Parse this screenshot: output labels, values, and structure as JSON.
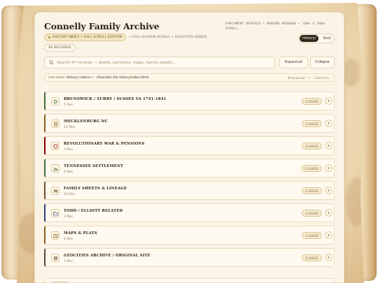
{
  "header": {
    "title": "Connelly Family Archive",
    "meta_right": "PARCHMENT #F0F5E3 • MAROON #880000 • 100% X 100% SCROLL",
    "badge": "HISTORY INDEX • FULL SCROLL EDITION",
    "badge_note": "• FULL-SCREEN SCROLL • GEOCITIES ADDED",
    "records": "46 RECORDS",
    "toggle": {
      "option_a": "History/",
      "option_b": "Root"
    }
  },
  "toolbar": {
    "search_placeholder": "Search 47 records — deeds, pensions, maps, family sheets...",
    "expand_label": "Expand all",
    "collapse_label": "Collapse"
  },
  "linkbar": {
    "mode_label": "Link mode:",
    "mode_value": "History/ relative • ../Geocities (for History/index.html)",
    "right": "Brunswick/ → ../Geociti…"
  },
  "rows": [
    {
      "name": "BRUNSWICK / SURRY / SUSSEX VA 1741-1841",
      "files": "5 files",
      "status": "CLOSED",
      "icon": "map-pin-icon",
      "accent": "#3f6b3a"
    },
    {
      "name": "MECKLENBURG NC",
      "files": "12 files",
      "status": "CLOSED",
      "icon": "scroll-icon",
      "accent": "#8a5a1e"
    },
    {
      "name": "REVOLUTIONARY WAR & PENSIONS",
      "files": "3 files",
      "status": "CLOSED",
      "icon": "shield-icon",
      "accent": "#880000"
    },
    {
      "name": "TENNESSEE SETTLEMENT",
      "files": "4 files",
      "status": "CLOSED",
      "icon": "mountain-icon",
      "accent": "#3f6b3a"
    },
    {
      "name": "FAMILY SHEETS & LINEAGE",
      "files": "16 files",
      "status": "CLOSED",
      "icon": "people-icon",
      "accent": "#6b4e2a"
    },
    {
      "name": "TODD / ELLIOTT RELATED",
      "files": "3 files",
      "status": "CLOSED",
      "icon": "folder-icon",
      "accent": "#2e3f7a"
    },
    {
      "name": "MAPS & PLATS",
      "files": "4 files",
      "status": "CLOSED",
      "icon": "map-icon",
      "accent": "#8a5a1e"
    },
    {
      "name": "GEOCITIES ARCHIVE / ORIGINAL SITE",
      "files": "1 files",
      "status": "CLOSED",
      "icon": "globe-icon",
      "accent": "#5c4a33"
    }
  ]
}
